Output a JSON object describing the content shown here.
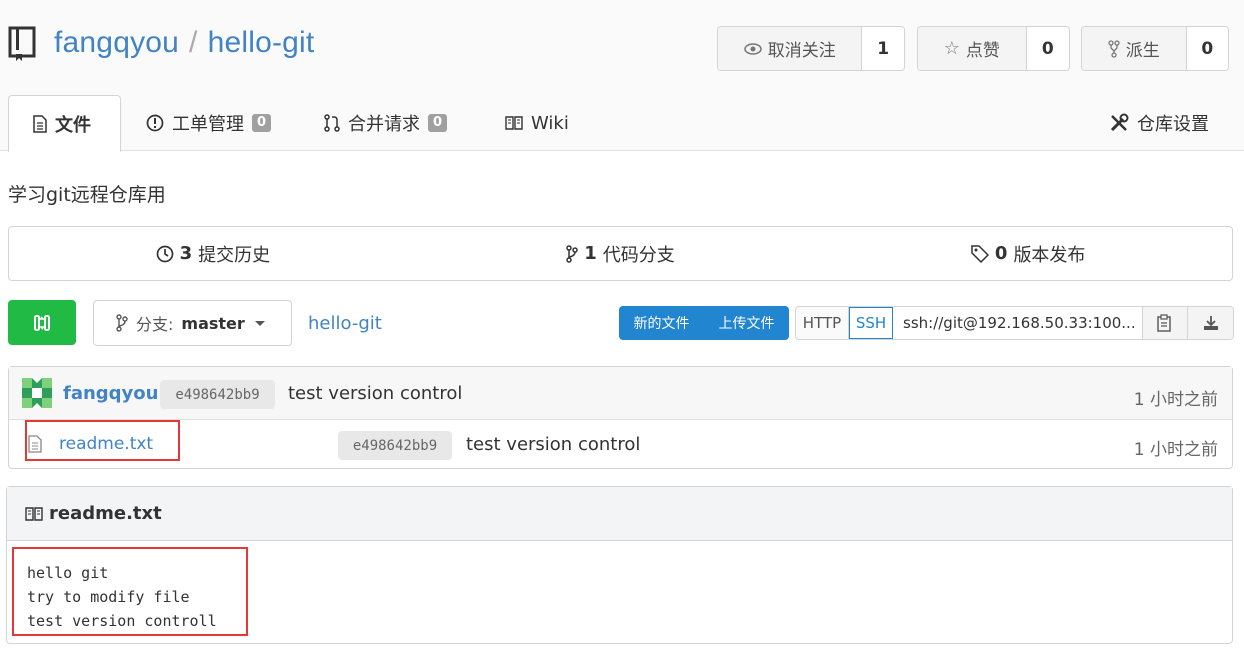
{
  "repo": {
    "owner": "fangqyou",
    "separator": "/",
    "name": "hello-git"
  },
  "actions": {
    "watch": {
      "label": "取消关注",
      "count": "1",
      "icon": "eye-icon"
    },
    "star": {
      "label": "点赞",
      "count": "0",
      "icon": "star-icon"
    },
    "fork": {
      "label": "派生",
      "count": "0",
      "icon": "fork-icon"
    }
  },
  "tabs": [
    {
      "label": "文件",
      "icon": "file-text-icon"
    },
    {
      "label": "工单管理",
      "count": "0",
      "icon": "alert-circle-icon"
    },
    {
      "label": "合并请求",
      "count": "0",
      "icon": "pull-request-icon"
    },
    {
      "label": "Wiki",
      "icon": "book-icon"
    },
    {
      "label": "仓库设置",
      "icon": "tools-icon"
    }
  ],
  "description": "学习git远程仓库用",
  "stats": [
    {
      "count": "3",
      "label": "提交历史",
      "icon": "history-icon"
    },
    {
      "count": "1",
      "label": "代码分支",
      "icon": "branch-icon"
    },
    {
      "count": "0",
      "label": "版本发布",
      "icon": "tag-icon"
    }
  ],
  "branch": {
    "prefix": "分支:",
    "name": "master"
  },
  "path": "hello-git",
  "file_actions": {
    "new_file": "新的文件",
    "upload_file": "上传文件"
  },
  "clone": {
    "http": "HTTP",
    "ssh": "SSH",
    "url": "ssh://git@192.168.50.33:100..."
  },
  "latest_commit": {
    "author": "fangqyou",
    "sha": "e498642bb9",
    "message": "test version control",
    "time": "1 小时之前"
  },
  "files": [
    {
      "name": "readme.txt",
      "sha": "e498642bb9",
      "message": "test version control",
      "time": "1 小时之前"
    }
  ],
  "readme": {
    "title": "readme.txt",
    "lines": [
      "hello git",
      "try to modify file",
      "test version controll"
    ]
  },
  "colors": {
    "accent": "#4183c4",
    "green": "#21ba45",
    "blue": "#2185d0",
    "highlight": "#e53935"
  }
}
